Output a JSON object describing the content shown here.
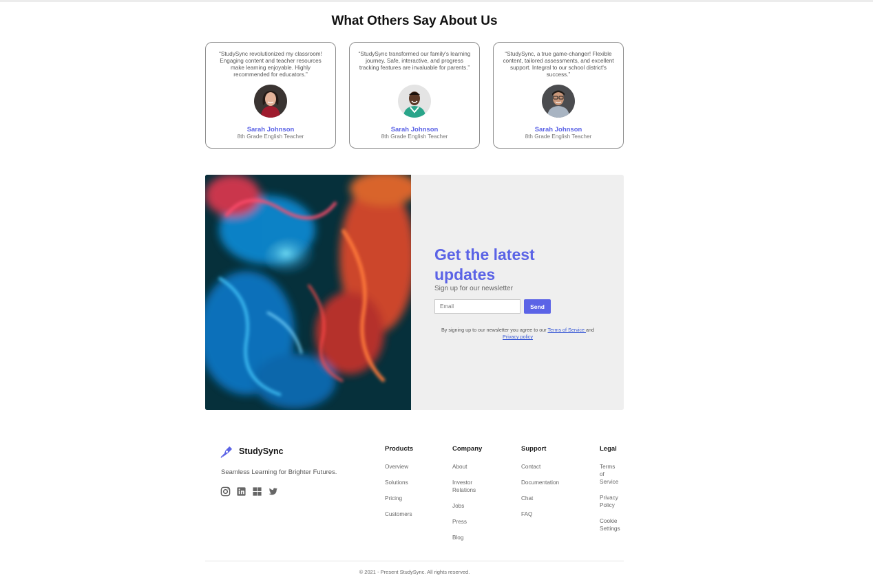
{
  "testimonials": {
    "title": "What Others Say About Us",
    "cards": [
      {
        "quote": "“StudySync revolutionized my classroom! Engaging content and teacher resources make learning enjoyable. Highly recommended for educators.”",
        "name": "Sarah Johnson",
        "role": "8th Grade English Teacher"
      },
      {
        "quote": "“StudySync transformed our family's learning journey. Safe, interactive, and progress tracking features are invaluable for parents.”",
        "name": "Sarah Johnson",
        "role": "8th Grade English Teacher"
      },
      {
        "quote": "“StudySync, a true game-changer! Flexible content, tailored assessments, and excellent support. Integral to our school district's success.”",
        "name": "Sarah Johnson",
        "role": "8th Grade English Teacher"
      }
    ]
  },
  "newsletter": {
    "title": "Get the latest updates",
    "subtitle": "Sign up for our newsletter",
    "email_placeholder": "Email",
    "send_label": "Send",
    "legal_prefix": "By signing up to our newsletter you agree to our ",
    "terms_label": "Terms of Service ",
    "legal_and": "and",
    "privacy_label": "Privacy policy"
  },
  "footer": {
    "brand": "StudySync",
    "tagline": "Seamless Learning for Brighter Futures.",
    "socials": [
      "instagram-icon",
      "linkedin-icon",
      "windows-icon",
      "twitter-icon"
    ],
    "columns": [
      {
        "heading": "Products",
        "links": [
          "Overview",
          "Solutions",
          "Pricing",
          "Customers"
        ]
      },
      {
        "heading": "Company",
        "links": [
          "About",
          "Investor Relations",
          "Jobs",
          "Press",
          "Blog"
        ]
      },
      {
        "heading": "Support",
        "links": [
          "Contact",
          "Documentation",
          "Chat",
          "FAQ"
        ]
      },
      {
        "heading": "Legal",
        "links": [
          "Terms of Service",
          "Privacy Policy",
          "Cookie Settings"
        ]
      }
    ],
    "copyright": "© 2021 - Present StudySync. All rights reserved."
  },
  "colors": {
    "accent": "#5b63e6",
    "newsletter_bg": "#efefef",
    "card_border": "#8e8e8e"
  }
}
